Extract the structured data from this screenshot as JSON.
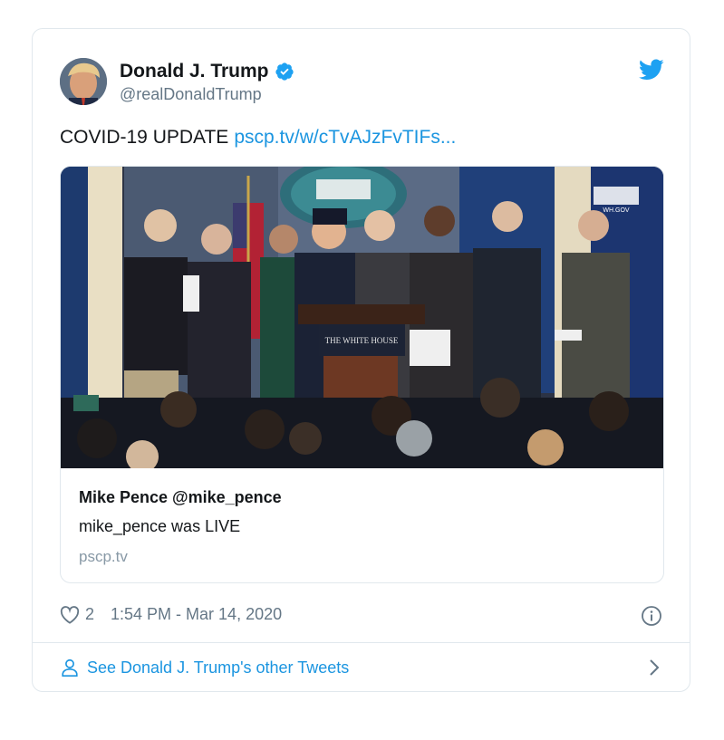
{
  "author": {
    "name": "Donald J. Trump",
    "handle": "@realDonaldTrump",
    "verified": true
  },
  "tweet": {
    "text": "COVID-19 UPDATE",
    "link_text": "pscp.tv/w/cTvAJzFvTIFs..."
  },
  "media_card": {
    "image_description_icon": "press-briefing-photo",
    "podium_label": "THE WHITE HOUSE",
    "corner_logo": "WH.GOV",
    "title": "Mike Pence @mike_pence",
    "description": "mike_pence was LIVE",
    "domain": "pscp.tv"
  },
  "meta": {
    "likes": "2",
    "timestamp": "1:54 PM - Mar 14, 2020"
  },
  "footer": {
    "see_more": "See Donald J. Trump's other Tweets"
  },
  "colors": {
    "link": "#1b95e0",
    "secondary_text": "#657786",
    "border": "#e1e8ed",
    "verified_blue": "#1da1f2"
  },
  "icons": [
    "verified-badge-icon",
    "twitter-bird-icon",
    "heart-icon",
    "info-icon",
    "person-icon",
    "chevron-right-icon"
  ]
}
